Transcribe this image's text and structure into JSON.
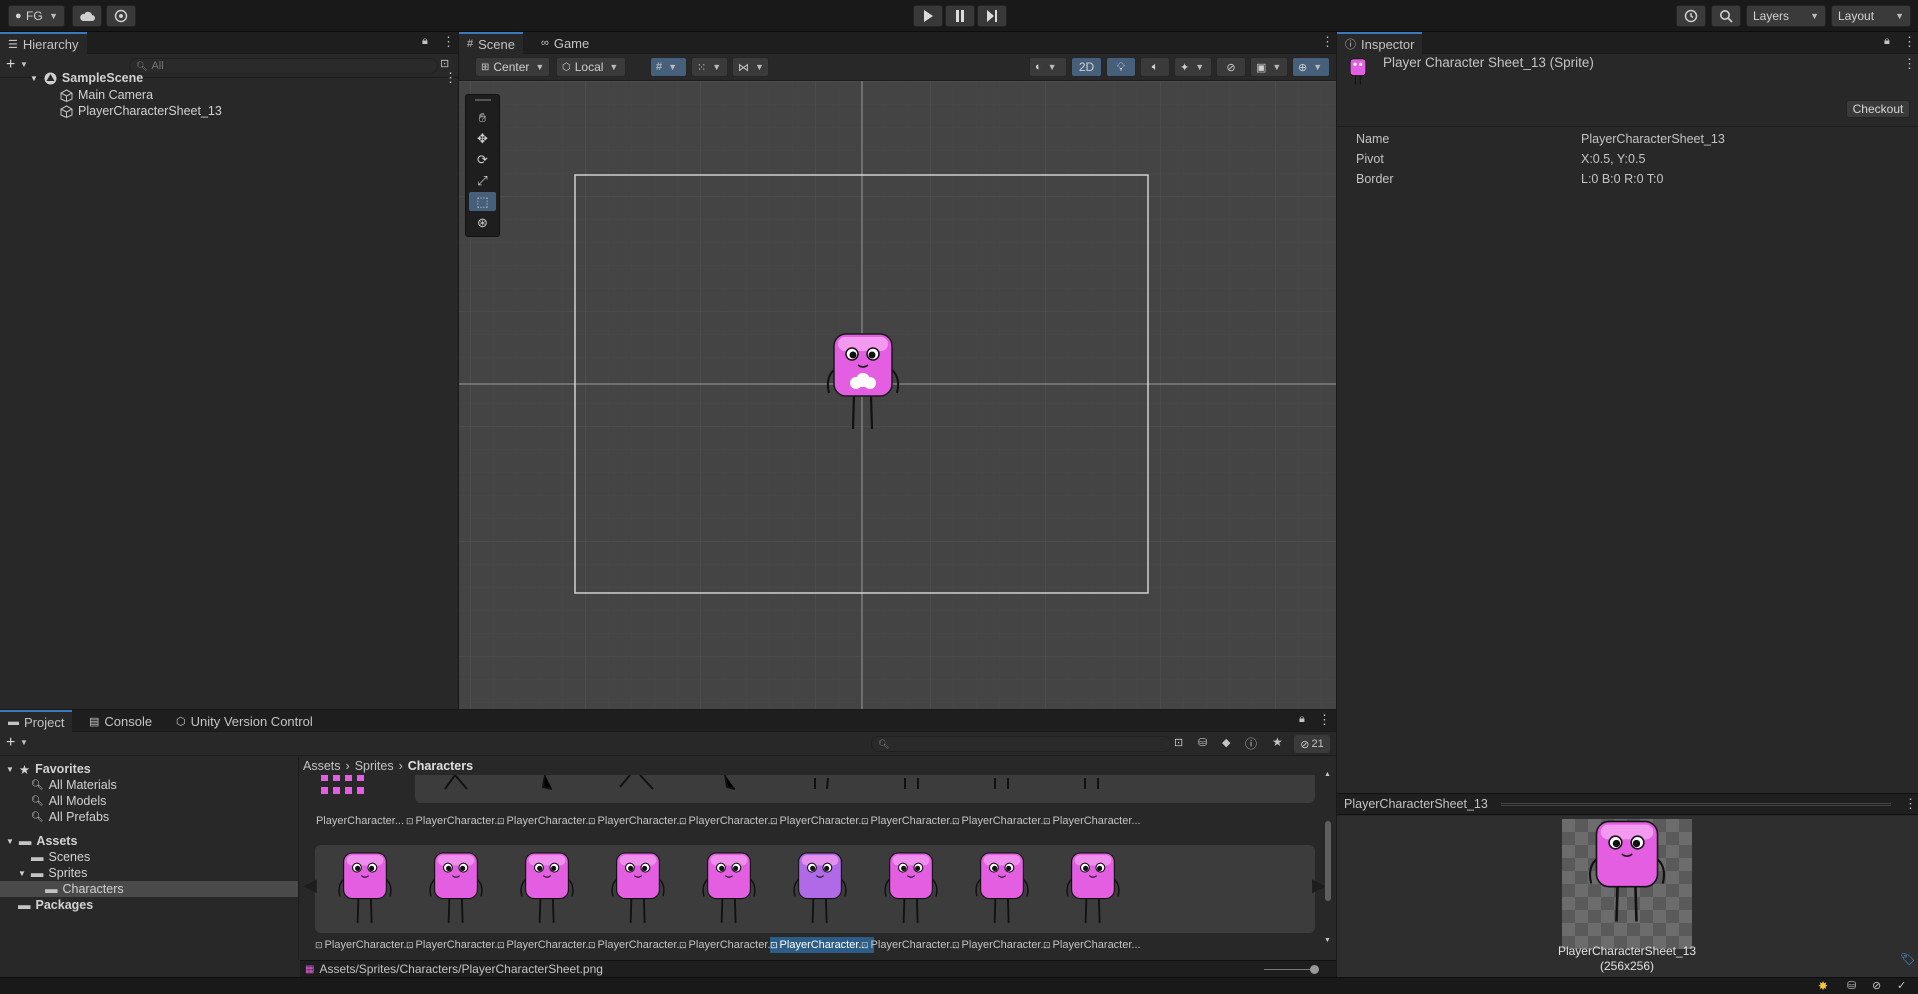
{
  "toolbar": {
    "account": "FG",
    "layers": "Layers",
    "layout": "Layout"
  },
  "hierarchy": {
    "tab": "Hierarchy",
    "search_placeholder": "All",
    "scene": "SampleScene",
    "items": [
      "Main Camera",
      "PlayerCharacterSheet_13"
    ]
  },
  "scene_view": {
    "tabs": [
      "Scene",
      "Game"
    ],
    "pivot": "Center",
    "space": "Local",
    "mode_2d": "2D"
  },
  "inspector": {
    "tab": "Inspector",
    "title": "Player Character Sheet_13 (Sprite)",
    "checkout": "Checkout",
    "fields": [
      {
        "label": "Name",
        "value": "PlayerCharacterSheet_13"
      },
      {
        "label": "Pivot",
        "value": "X:0.5, Y:0.5"
      },
      {
        "label": "Border",
        "value": "L:0 B:0 R:0 T:0"
      }
    ],
    "preview_header": "PlayerCharacterSheet_13",
    "preview_name": "PlayerCharacterSheet_13",
    "preview_size": "(256x256)"
  },
  "project": {
    "tabs": [
      "Project",
      "Console",
      "Unity Version Control"
    ],
    "hidden_count": "21",
    "breadcrumb": [
      "Assets",
      "Sprites",
      "Characters"
    ],
    "favorites_label": "Favorites",
    "favorites": [
      "All Materials",
      "All Models",
      "All Prefabs"
    ],
    "assets_label": "Assets",
    "folders": [
      "Scenes",
      "Sprites",
      "Characters"
    ],
    "packages_label": "Packages",
    "row1_labels": [
      "PlayerCharacter...",
      "PlayerCharacter...",
      "PlayerCharacter...",
      "PlayerCharacter...",
      "PlayerCharacter...",
      "PlayerCharacter...",
      "PlayerCharacter...",
      "PlayerCharacter...",
      "PlayerCharacter..."
    ],
    "row2_labels": [
      "PlayerCharacter...",
      "PlayerCharacter...",
      "PlayerCharacter...",
      "PlayerCharacter...",
      "PlayerCharacter...",
      "PlayerCharacter...",
      "PlayerCharacter...",
      "PlayerCharacter...",
      "PlayerCharacter..."
    ],
    "selected_index": 5,
    "status_path": "Assets/Sprites/Characters/PlayerCharacterSheet.png"
  },
  "colors": {
    "accent": "#3a79bb",
    "selection": "#2c5d87",
    "character_pink": "#e35ee0"
  }
}
